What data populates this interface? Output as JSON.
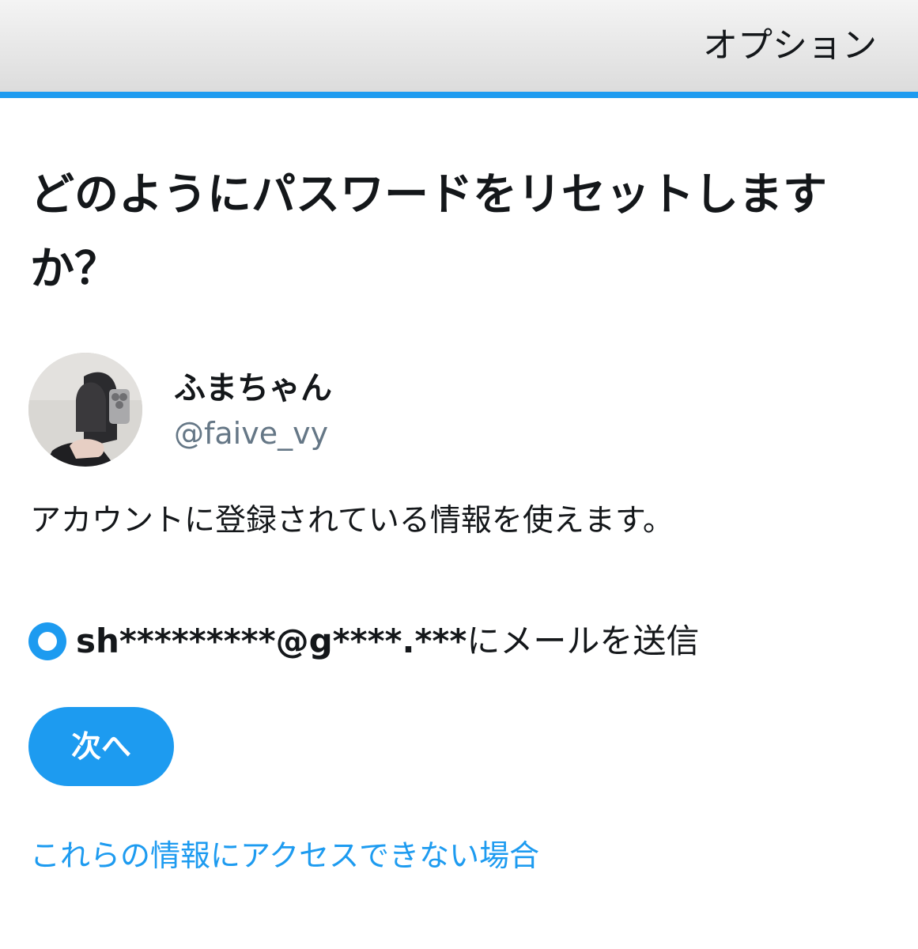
{
  "header": {
    "options_label": "オプション",
    "accent_color": "#1d9bf0"
  },
  "main": {
    "title": "どのようにパスワードをリセットしますか？",
    "account": {
      "display_name": "ふまちゃん",
      "handle": "@faive_vy"
    },
    "info_text": "アカウントに登録されている情報を使えます。",
    "option": {
      "selected": true,
      "masked_email": "sh*********@g****.***",
      "suffix": "にメールを送信"
    },
    "next_label": "次へ",
    "help_link": "これらの情報にアクセスできない場合"
  }
}
